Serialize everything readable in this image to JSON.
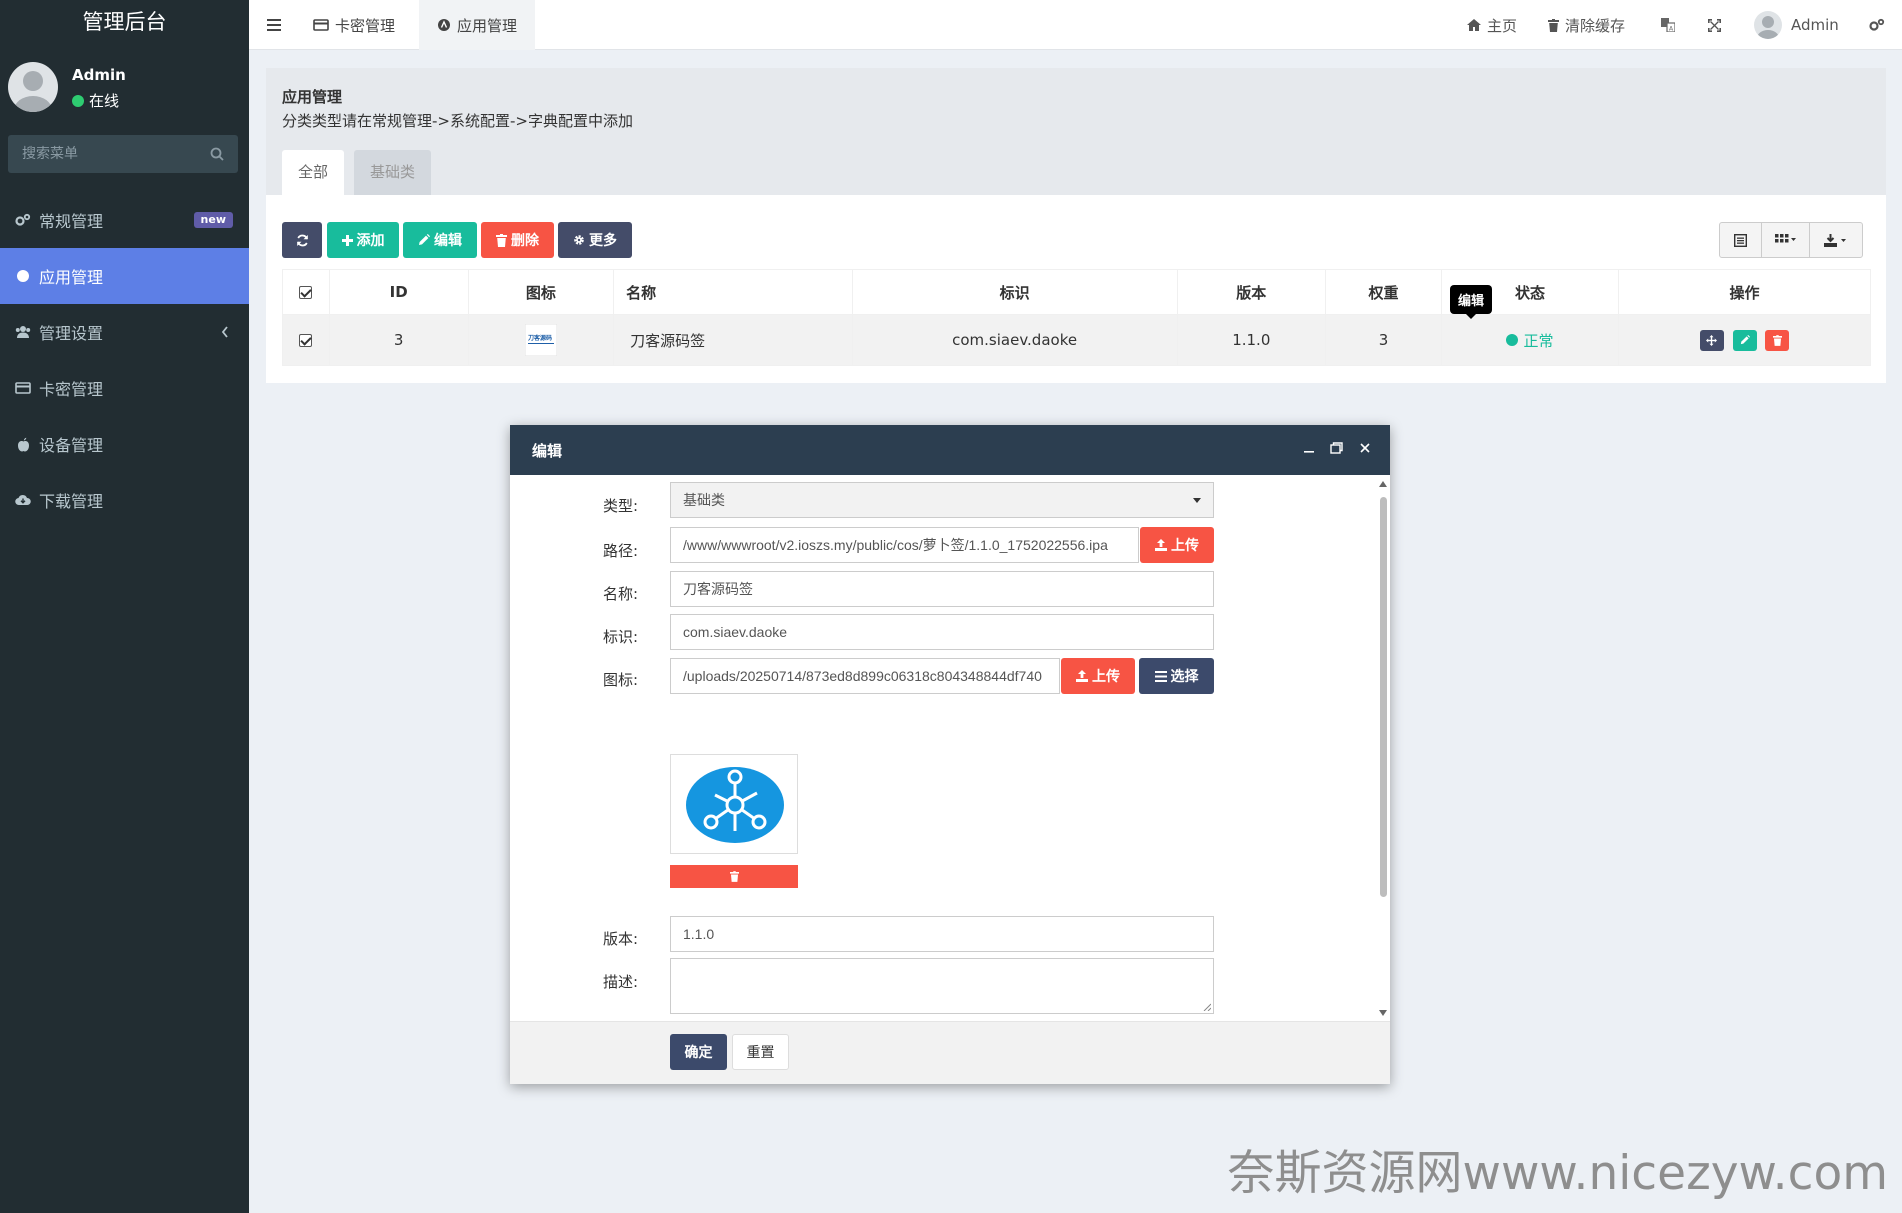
{
  "sidebar": {
    "logo": "管理后台",
    "user": {
      "name": "Admin",
      "status": "在线"
    },
    "search_placeholder": "搜索菜单",
    "items": [
      {
        "label": "常规管理",
        "icon": "gears-icon",
        "badge": "new"
      },
      {
        "label": "应用管理",
        "icon": "circle-icon",
        "active": true
      },
      {
        "label": "管理设置",
        "icon": "users-icon",
        "chevron": true
      },
      {
        "label": "卡密管理",
        "icon": "credit-card-icon"
      },
      {
        "label": "设备管理",
        "icon": "apple-icon"
      },
      {
        "label": "下载管理",
        "icon": "cloud-download-icon"
      }
    ]
  },
  "topbar": {
    "tabs": [
      {
        "label": "卡密管理",
        "icon": "credit-card-icon"
      },
      {
        "label": "应用管理",
        "icon": "circle-icon",
        "active": true
      }
    ],
    "home": "主页",
    "clear_cache": "清除缓存",
    "user": "Admin"
  },
  "header": {
    "title": "应用管理",
    "subtitle": "分类类型请在常规管理->系统配置->字典配置中添加",
    "tabs": [
      "全部",
      "基础类"
    ]
  },
  "toolbar": {
    "add": "添加",
    "edit": "编辑",
    "delete": "删除",
    "more": "更多"
  },
  "table": {
    "columns": [
      "ID",
      "图标",
      "名称",
      "标识",
      "版本",
      "权重",
      "状态",
      "操作"
    ],
    "rows": [
      {
        "id": "3",
        "name": "刀客源码签",
        "identifier": "com.siaev.daoke",
        "version": "1.1.0",
        "weight": "3",
        "status": "正常"
      }
    ],
    "tooltip": "编辑"
  },
  "modal": {
    "title": "编辑",
    "fields": {
      "type_label": "类型:",
      "type_value": "基础类",
      "path_label": "路径:",
      "path_value": "/www/wwwroot/v2.ioszs.my/public/cos/萝卜签/1.1.0_1752022556.ipa",
      "name_label": "名称:",
      "name_value": "刀客源码签",
      "ident_label": "标识:",
      "ident_value": "com.siaev.daoke",
      "icon_label": "图标:",
      "icon_value": "/uploads/20250714/873ed8d899c06318c804348844df740",
      "version_label": "版本:",
      "version_value": "1.1.0",
      "desc_label": "描述:"
    },
    "upload": "上传",
    "choose": "选择",
    "ok": "确定",
    "reset": "重置"
  },
  "watermark": "奈斯资源网www.nicezyw.com",
  "colors": {
    "sidebar": "#222d32",
    "active": "#5d7fe6",
    "green": "#18bc9c",
    "red": "#f75444",
    "dark": "#444c69",
    "modal_head": "#2c3e50"
  }
}
